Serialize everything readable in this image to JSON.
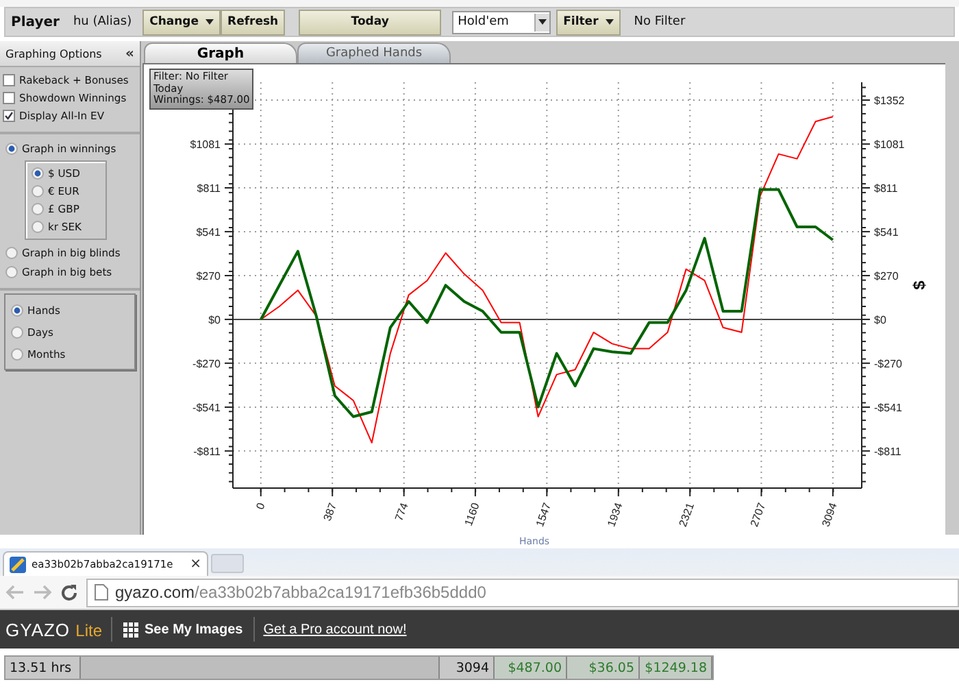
{
  "toolbar": {
    "player_label": "Player",
    "player_name": "hu (Alias)",
    "buttons": [
      {
        "label": "Change",
        "dropdown": true
      },
      {
        "label": "Refresh",
        "dropdown": false
      }
    ],
    "today_button": "Today",
    "game_select": "Hold'em",
    "filter_button": {
      "label": "Filter",
      "dropdown": true
    },
    "filter_status": "No Filter"
  },
  "sidebar": {
    "title": "Graphing Options",
    "collapse_icon": "«",
    "checkboxes": [
      {
        "label": "Rakeback + Bonuses",
        "checked": false
      },
      {
        "label": "Showdown Winnings",
        "checked": false
      },
      {
        "label": "Display All-In EV",
        "checked": true
      }
    ],
    "graph_modes": [
      {
        "label": "Graph in winnings",
        "selected": true,
        "options": [
          {
            "label": "$ USD",
            "selected": true
          },
          {
            "label": "€ EUR",
            "selected": false
          },
          {
            "label": "£ GBP",
            "selected": false
          },
          {
            "label": "kr SEK",
            "selected": false
          }
        ]
      },
      {
        "label": "Graph in big blinds",
        "selected": false
      },
      {
        "label": "Graph in big bets",
        "selected": false
      }
    ],
    "time_units": [
      {
        "label": "Hands",
        "selected": true
      },
      {
        "label": "Days",
        "selected": false
      },
      {
        "label": "Months",
        "selected": false
      }
    ]
  },
  "tabs": [
    {
      "label": "Graph",
      "selected": true
    },
    {
      "label": "Graphed Hands",
      "selected": false
    }
  ],
  "chart": {
    "info_lines": [
      "Filter: No Filter",
      "Today",
      "Winnings: $487.00"
    ],
    "chart_data": {
      "type": "line",
      "xlabel": "Hands",
      "ylabel": "$",
      "x": [
        0,
        100,
        200,
        300,
        400,
        500,
        600,
        700,
        800,
        900,
        1000,
        1100,
        1200,
        1300,
        1400,
        1500,
        1600,
        1700,
        1800,
        1900,
        2000,
        2100,
        2200,
        2300,
        2400,
        2500,
        2600,
        2700,
        2800,
        2900,
        3000,
        3094
      ],
      "series": [
        {
          "color": "#ff0000",
          "values": [
            0,
            80,
            180,
            20,
            -410,
            -500,
            -760,
            -210,
            150,
            240,
            410,
            280,
            180,
            -20,
            -20,
            -600,
            -340,
            -310,
            -80,
            -150,
            -180,
            -180,
            -80,
            310,
            240,
            -50,
            -80,
            760,
            1020,
            990,
            1220,
            1250
          ]
        },
        {
          "color": "#006400",
          "values": [
            0,
            210,
            420,
            20,
            -470,
            -600,
            -570,
            -50,
            110,
            -20,
            210,
            110,
            50,
            -80,
            -80,
            -540,
            -210,
            -410,
            -180,
            -200,
            -210,
            -20,
            -20,
            180,
            500,
            50,
            50,
            800,
            800,
            570,
            570,
            490
          ]
        }
      ],
      "grid": true,
      "xlim": [
        -151,
        3250
      ],
      "ylim": [
        -1040,
        1462
      ],
      "xticks": [
        0,
        387,
        774,
        1160,
        1547,
        1934,
        2321,
        2707,
        3094
      ],
      "yticks": [
        {
          "value": -811,
          "label": "-$811"
        },
        {
          "value": -541,
          "label": "-$541"
        },
        {
          "value": -270,
          "label": "-$270"
        },
        {
          "value": 0,
          "label": "$0"
        },
        {
          "value": 270,
          "label": "$270"
        },
        {
          "value": 541,
          "label": "$541"
        },
        {
          "value": 811,
          "label": "$811"
        },
        {
          "value": 1081,
          "label": "$1081"
        },
        {
          "value": 1352,
          "label": "$1352"
        }
      ]
    }
  },
  "browser": {
    "tab_title": "ea33b02b7abba2ca19171e",
    "tab_close": "×",
    "url_host": "gyazo.com",
    "url_path": "/ea33b02b7abba2ca19171efb36b5ddd0",
    "brand": "GYAZO",
    "brand_suffix": "Lite",
    "nav_link": "See My Images",
    "promo_link": "Get a Pro account now!"
  },
  "status_bar": {
    "cells": [
      {
        "text": "13.51 hrs",
        "kind": "label"
      },
      {
        "text": "3094",
        "kind": "number"
      },
      {
        "text": "$487.00",
        "kind": "money"
      },
      {
        "text": "$36.05",
        "kind": "money"
      },
      {
        "text": "$1249.18",
        "kind": "money"
      }
    ]
  }
}
